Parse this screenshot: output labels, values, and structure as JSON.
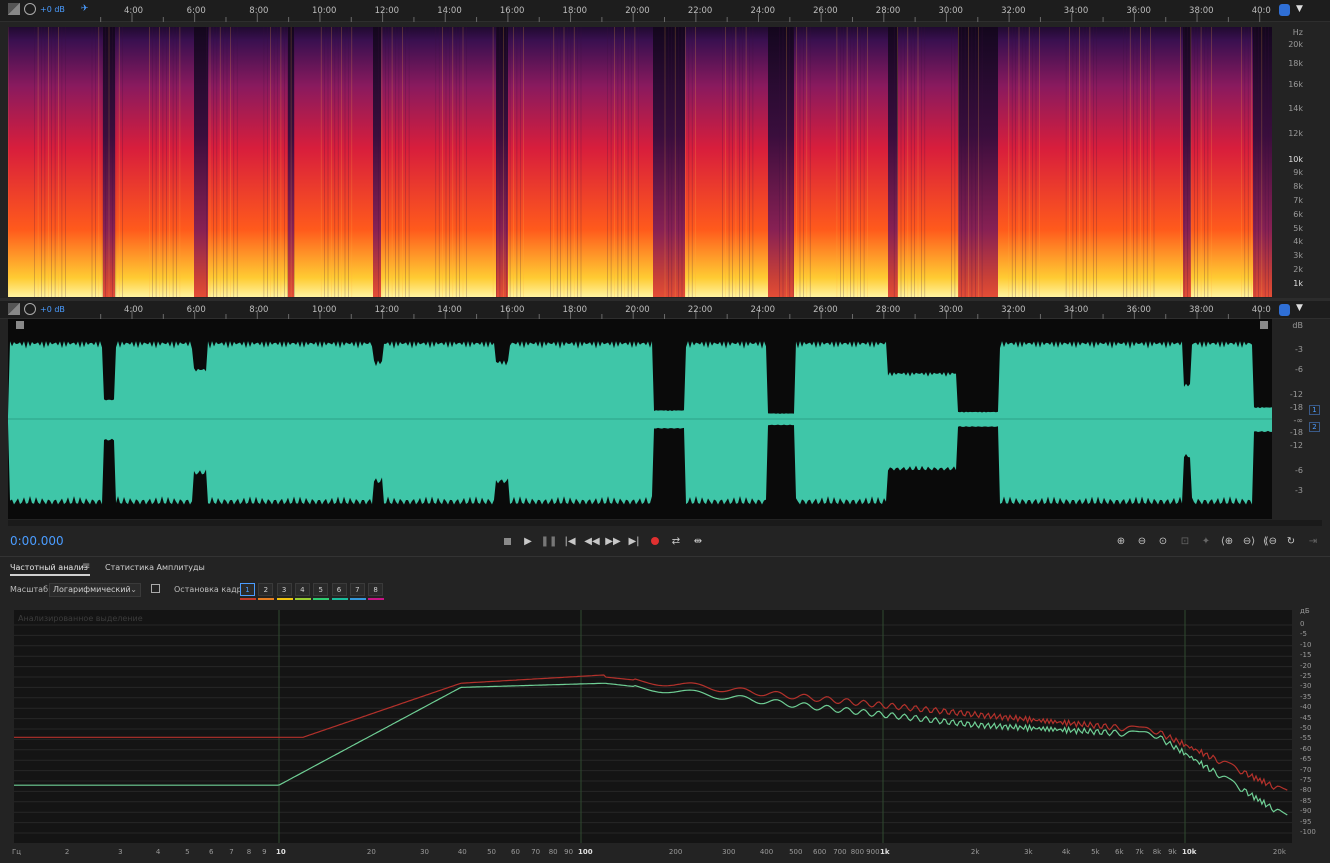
{
  "colors": {
    "waveform": "#3fc6a8",
    "accent": "#4a9cff",
    "trace_red": "#b3312b",
    "trace_green": "#6fcf95"
  },
  "top_ruler": {
    "gain": "+0 dB",
    "ticks": [
      "4:00",
      "6:00",
      "8:00",
      "10:00",
      "12:00",
      "14:00",
      "16:00",
      "18:00",
      "20:00",
      "22:00",
      "24:00",
      "26:00",
      "28:00",
      "30:00",
      "32:00",
      "34:00",
      "36:00",
      "38:00",
      "40:0"
    ]
  },
  "wave_ruler": {
    "gain": "+0 dB"
  },
  "spectral_scale": {
    "unit": "Hz",
    "labels": [
      "20k",
      "18k",
      "16k",
      "14k",
      "12k",
      "10k",
      "9k",
      "8k",
      "7k",
      "6k",
      "5k",
      "4k",
      "3k",
      "2k",
      "1k"
    ]
  },
  "wave_scale": {
    "unit": "dB",
    "labels": [
      "-3",
      "-6",
      "-12",
      "-18",
      "-∞",
      "-18",
      "-12",
      "-6",
      "-3"
    ],
    "channels": [
      "1",
      "2"
    ]
  },
  "transport": {
    "time": "0:00.000",
    "buttons": [
      "stop-icon",
      "play-icon",
      "pause-icon",
      "go-start-icon",
      "rewind-icon",
      "fast-forward-icon",
      "go-end-icon",
      "record-icon",
      "loop-icon",
      "skip-selection-icon"
    ]
  },
  "tabs": {
    "freq_analysis": "Частотный анализ",
    "amp_stats": "Статистика Амплитуды"
  },
  "controls": {
    "scale_label": "Масштаб:",
    "scale_value": "Логарифмический",
    "freeze_label": "Остановка кадра:",
    "frames": [
      "1",
      "2",
      "3",
      "4",
      "5",
      "6",
      "7",
      "8"
    ],
    "frame_colors": [
      "#c0392b",
      "#e67e22",
      "#f1c40f",
      "#9acd32",
      "#2ecc71",
      "#1abc9c",
      "#3498db",
      "#c71585"
    ]
  },
  "analysis": {
    "watermark": "Анализированное выделение",
    "db_unit": "дБ",
    "db_labels": [
      "0",
      "-5",
      "-10",
      "-15",
      "-20",
      "-25",
      "-30",
      "-35",
      "-40",
      "-45",
      "-50",
      "-55",
      "-60",
      "-65",
      "-70",
      "-75",
      "-80",
      "-85",
      "-90",
      "-95",
      "-100"
    ],
    "freq_unit": "Гц",
    "freq_labels": [
      "2",
      "3",
      "4",
      "5",
      "6",
      "7",
      "8",
      "9",
      "10",
      "20",
      "30",
      "40",
      "50",
      "60",
      "70",
      "80",
      "90",
      "100",
      "200",
      "300",
      "400",
      "500",
      "600",
      "700",
      "800",
      "900",
      "1k",
      "2k",
      "3k",
      "4k",
      "5k",
      "6k",
      "7k",
      "8k",
      "9k",
      "10k",
      "20k"
    ]
  }
}
